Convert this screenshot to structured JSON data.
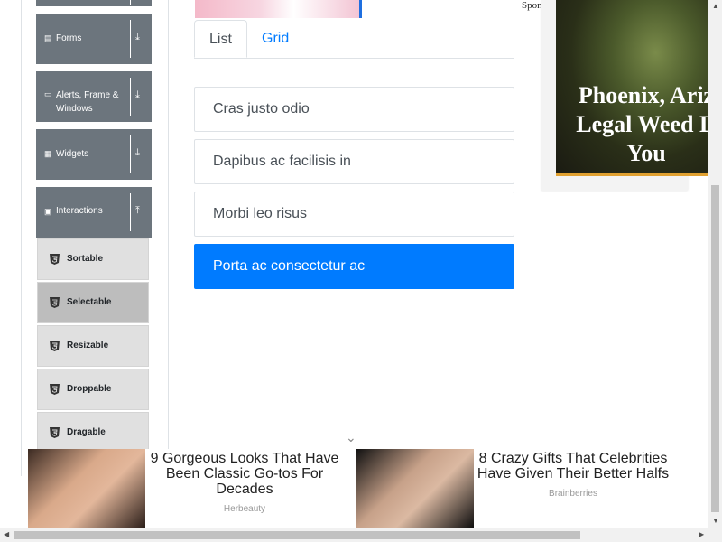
{
  "sidebar": {
    "groups": [
      {
        "label": "Forms",
        "icon": "form-icon"
      },
      {
        "label": "Alerts, Frame & Windows",
        "icon": "window-icon"
      },
      {
        "label": "Widgets",
        "icon": "widgets-icon"
      },
      {
        "label": "Interactions",
        "icon": "interactions-icon"
      }
    ],
    "interactions": [
      {
        "label": "Sortable"
      },
      {
        "label": "Selectable"
      },
      {
        "label": "Resizable"
      },
      {
        "label": "Droppable"
      },
      {
        "label": "Dragable"
      }
    ]
  },
  "tabs": [
    {
      "label": "List"
    },
    {
      "label": "Grid"
    }
  ],
  "list": [
    {
      "label": "Cras justo odio"
    },
    {
      "label": "Dapibus ac facilisis in"
    },
    {
      "label": "Morbi leo risus"
    },
    {
      "label": "Porta ac consectetur ac"
    }
  ],
  "ad_right": {
    "sponsored": "Spon",
    "headline": "Phoenix, Ariz\nLegal Weed D\nYou"
  },
  "ad_bottom": {
    "cards": [
      {
        "title": "9 Gorgeous Looks That Have Been Classic Go-tos For Decades",
        "source": "Herbeauty"
      },
      {
        "title": "8 Crazy Gifts That Celebrities Have Given Their Better Halfs",
        "source": "Brainberries"
      }
    ]
  },
  "colors": {
    "accent": "#007bff",
    "sidebar_group": "#6c757d",
    "sidebar_item": "#e0e0e0",
    "sidebar_item_active": "#bdbdbd"
  }
}
